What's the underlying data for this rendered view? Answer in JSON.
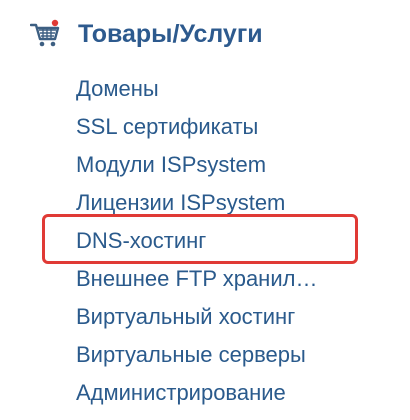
{
  "section": {
    "title": "Товары/Услуги",
    "icon": "shopping-cart-icon",
    "icon_color": "#3d5f82",
    "badge_color": "#e03a35"
  },
  "menu": {
    "items": [
      {
        "label": "Домены"
      },
      {
        "label": "SSL сертификаты"
      },
      {
        "label": "Модули ISPsystem"
      },
      {
        "label": "Лицензии ISPsystem"
      },
      {
        "label": "DNS-хостинг",
        "highlighted": true
      },
      {
        "label": "Внешнее FTP хранил…"
      },
      {
        "label": "Виртуальный хостинг"
      },
      {
        "label": "Виртуальные серверы"
      },
      {
        "label": "Администрирование"
      }
    ]
  },
  "colors": {
    "title": "#2d5a8e",
    "link": "#2a5a8c",
    "highlight_border": "#e03a35"
  }
}
